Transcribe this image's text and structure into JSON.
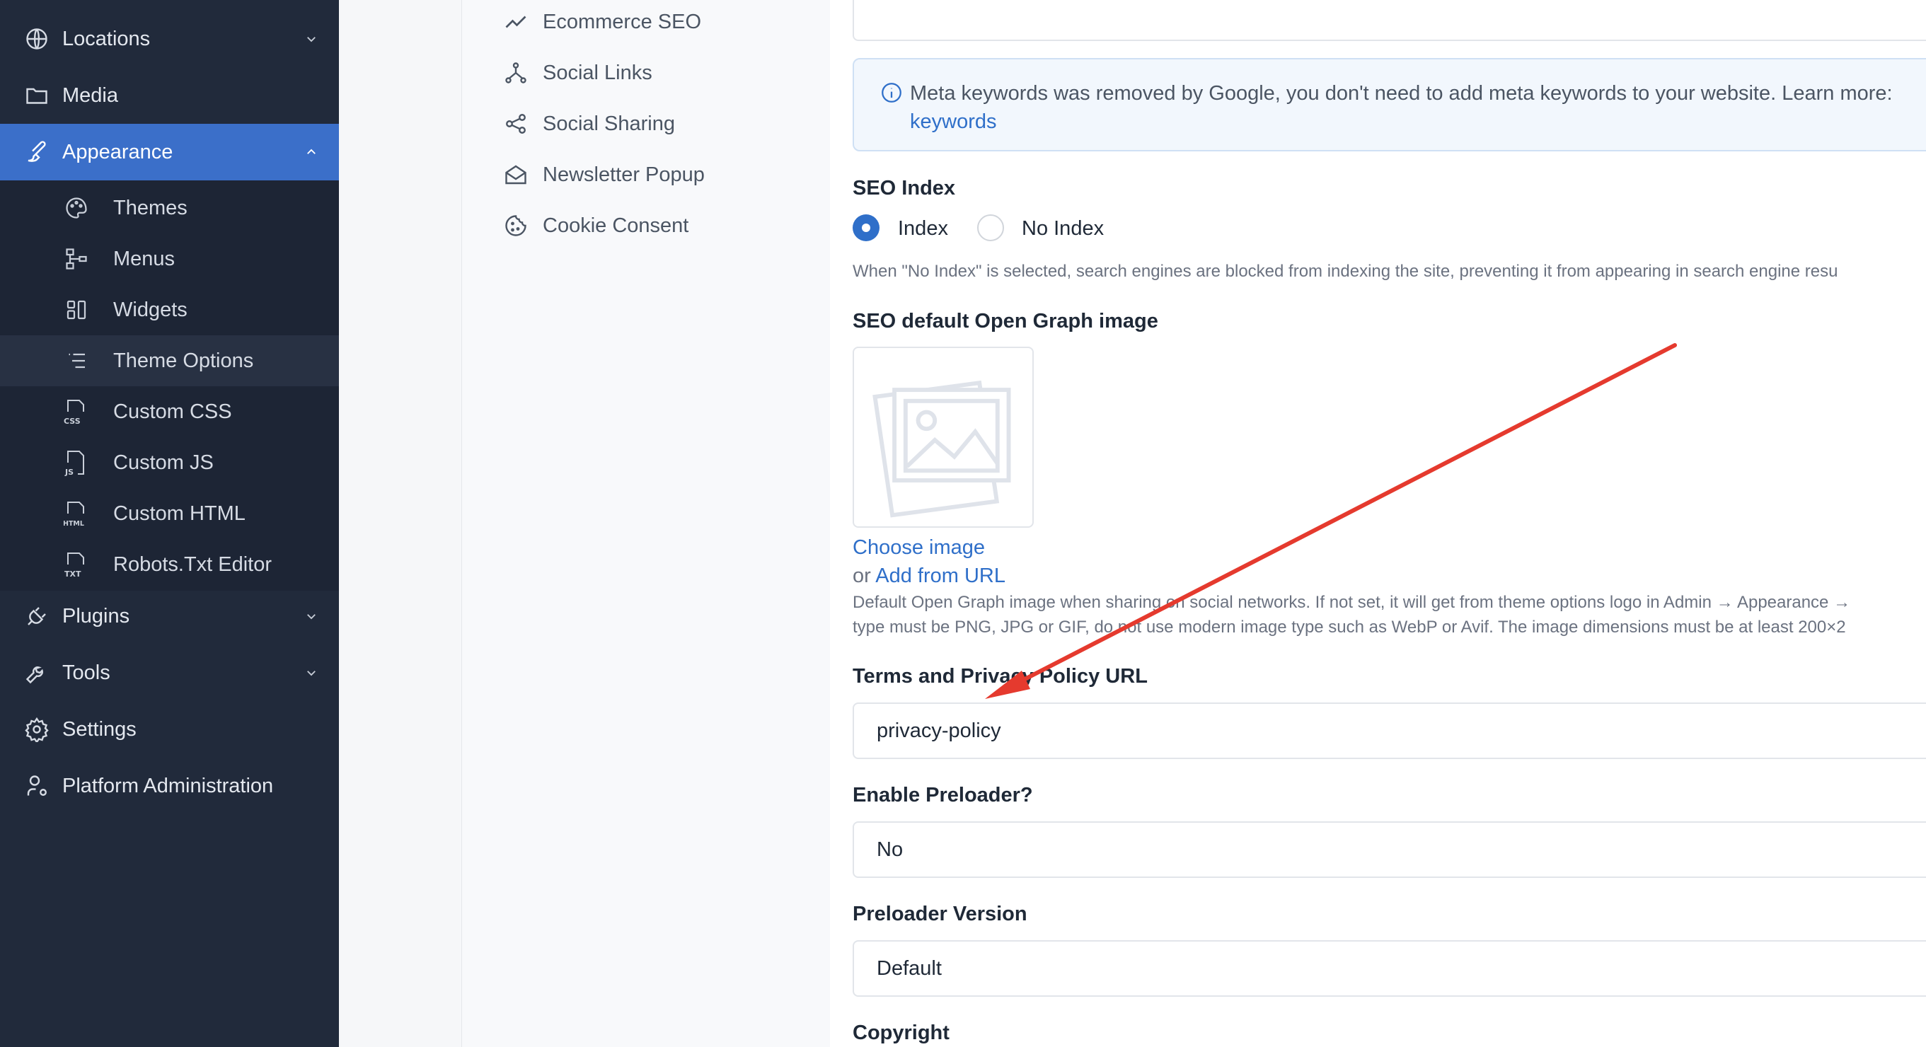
{
  "sidebar": {
    "items": [
      {
        "label": "Locations"
      },
      {
        "label": "Media"
      },
      {
        "label": "Appearance"
      },
      {
        "label": "Plugins"
      },
      {
        "label": "Tools"
      },
      {
        "label": "Settings"
      },
      {
        "label": "Platform Administration"
      }
    ],
    "appearance_submenu": [
      {
        "label": "Themes"
      },
      {
        "label": "Menus"
      },
      {
        "label": "Widgets"
      },
      {
        "label": "Theme Options"
      },
      {
        "label": "Custom CSS"
      },
      {
        "label": "Custom JS"
      },
      {
        "label": "Custom HTML"
      },
      {
        "label": "Robots.Txt Editor"
      }
    ],
    "icon_texts": {
      "css": "CSS",
      "js": "JS",
      "html": "HTML",
      "txt": "TXT"
    }
  },
  "settings_nav": {
    "items": [
      {
        "label": "Ecommerce SEO",
        "icon": "trend-line-icon"
      },
      {
        "label": "Social Links",
        "icon": "nodes-icon"
      },
      {
        "label": "Social Sharing",
        "icon": "share-icon"
      },
      {
        "label": "Newsletter Popup",
        "icon": "mail-open-icon"
      },
      {
        "label": "Cookie Consent",
        "icon": "cookie-icon"
      }
    ]
  },
  "form": {
    "meta_alert": {
      "line1": "Meta keywords was removed by Google, you don't need to add meta keywords to your website. Learn more:",
      "link": "keywords"
    },
    "seo_index": {
      "label": "SEO Index",
      "options": [
        "Index",
        "No Index"
      ],
      "selected": "Index",
      "help": "When \"No Index\" is selected, search engines are blocked from indexing the site, preventing it from appearing in search engine resu"
    },
    "og_image": {
      "label": "SEO default Open Graph image",
      "choose": "Choose image",
      "or": "or",
      "add_url": "Add from URL",
      "help_line1": "Default Open Graph image when sharing on social networks. If not set, it will get from theme options logo in Admin → Appearance →",
      "help_line2": "type must be PNG, JPG or GIF, do not use modern image type such as WebP or Avif. The image dimensions must be at least 200×2"
    },
    "privacy_url": {
      "label": "Terms and Privacy Policy URL",
      "value": "privacy-policy"
    },
    "preloader": {
      "label": "Enable Preloader?",
      "value": "No"
    },
    "preloader_version": {
      "label": "Preloader Version",
      "value": "Default"
    },
    "copyright": {
      "label": "Copyright"
    }
  },
  "colors": {
    "sidebar_bg": "#212a3b",
    "active_bg": "#3b6fc9",
    "link": "#2f6fc9",
    "annotation_arrow": "#e53a2e"
  }
}
